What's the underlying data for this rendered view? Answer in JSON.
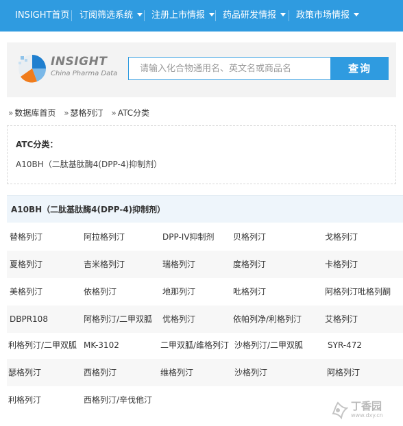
{
  "nav": {
    "home": "INSIGHT首页",
    "items": [
      {
        "label": "订阅筛选系统"
      },
      {
        "label": "注册上市情报"
      },
      {
        "label": "药品研发情报"
      },
      {
        "label": "政策市场情报"
      }
    ]
  },
  "logo": {
    "brand": "INSIGHT",
    "tagline": "China Pharma Data"
  },
  "search": {
    "placeholder": "请输入化合物通用名、英文名或商品名",
    "button": "查询"
  },
  "breadcrumb": {
    "items": [
      "数据库首页",
      "瑟格列汀",
      "ATC分类"
    ]
  },
  "atc": {
    "title": "ATC分类：",
    "value": "A10BH（二肽基肽酶4(DPP-4)抑制剂）"
  },
  "section": {
    "title": "A10BH（二肽基肽酶4(DPP-4)抑制剂）"
  },
  "drugs": {
    "rows": [
      [
        "替格列汀",
        "阿拉格列汀",
        "DPP-IV抑制剂",
        "贝格列汀",
        "戈格列汀"
      ],
      [
        "夏格列汀",
        "吉米格列汀",
        "瑞格列汀",
        "度格列汀",
        "卡格列汀"
      ],
      [
        "美格列汀",
        "依格列汀",
        "地那列汀",
        "吡格列汀",
        "阿格列汀吡格列酮"
      ],
      [
        "DBPR108",
        "阿格列汀/二甲双胍",
        "优格列汀",
        "依帕列净/利格列汀",
        "艾格列汀"
      ],
      [
        "利格列汀/二甲双胍",
        "MK-3102",
        "二甲双胍/维格列汀",
        "沙格列汀/二甲双胍",
        "SYR-472"
      ],
      [
        "瑟格列汀",
        "西格列汀",
        "维格列汀",
        "沙格列汀",
        "阿格列汀"
      ],
      [
        "利格列汀",
        "西格列汀/辛伐他汀"
      ]
    ]
  },
  "watermark": {
    "text": "丁香园",
    "url": "www.dxy.cn"
  }
}
